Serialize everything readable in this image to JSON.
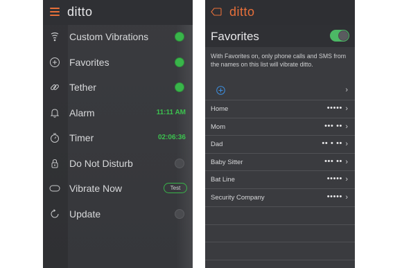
{
  "left": {
    "app_title": "ditto",
    "rows": [
      {
        "label": "Custom Vibrations",
        "icon": "vibration-icon",
        "state": "on"
      },
      {
        "label": "Favorites",
        "icon": "plus-circle-icon",
        "state": "on"
      },
      {
        "label": "Tether",
        "icon": "link-icon",
        "state": "on"
      },
      {
        "label": "Alarm",
        "icon": "bell-icon",
        "time": "11:11 AM"
      },
      {
        "label": "Timer",
        "icon": "timer-icon",
        "time": "02:06:36"
      },
      {
        "label": "Do Not Disturb",
        "icon": "lock-icon",
        "state": "off"
      },
      {
        "label": "Vibrate Now",
        "icon": "vibrate-now-icon",
        "button": "Test"
      },
      {
        "label": "Update",
        "icon": "refresh-icon",
        "state": "off"
      }
    ]
  },
  "right": {
    "app_title": "ditto",
    "section_title": "Favorites",
    "toggle_state": "on",
    "description": "With Favorites on, only phone calls and SMS from the names on this list will vibrate ditto.",
    "contacts": [
      {
        "name": "Home",
        "pattern": "•••••"
      },
      {
        "name": "Mom",
        "pattern": "••• ••"
      },
      {
        "name": "Dad",
        "pattern": "•• • ••"
      },
      {
        "name": "Baby Sitter",
        "pattern": "••• ••"
      },
      {
        "name": "Bat Line",
        "pattern": "•••••"
      },
      {
        "name": "Security Company",
        "pattern": "•••••"
      }
    ]
  },
  "colors": {
    "accent_orange": "#e8703a",
    "status_green": "#39b54a",
    "time_green": "#3cc24f",
    "panel_bg": "#3a3b3f"
  }
}
